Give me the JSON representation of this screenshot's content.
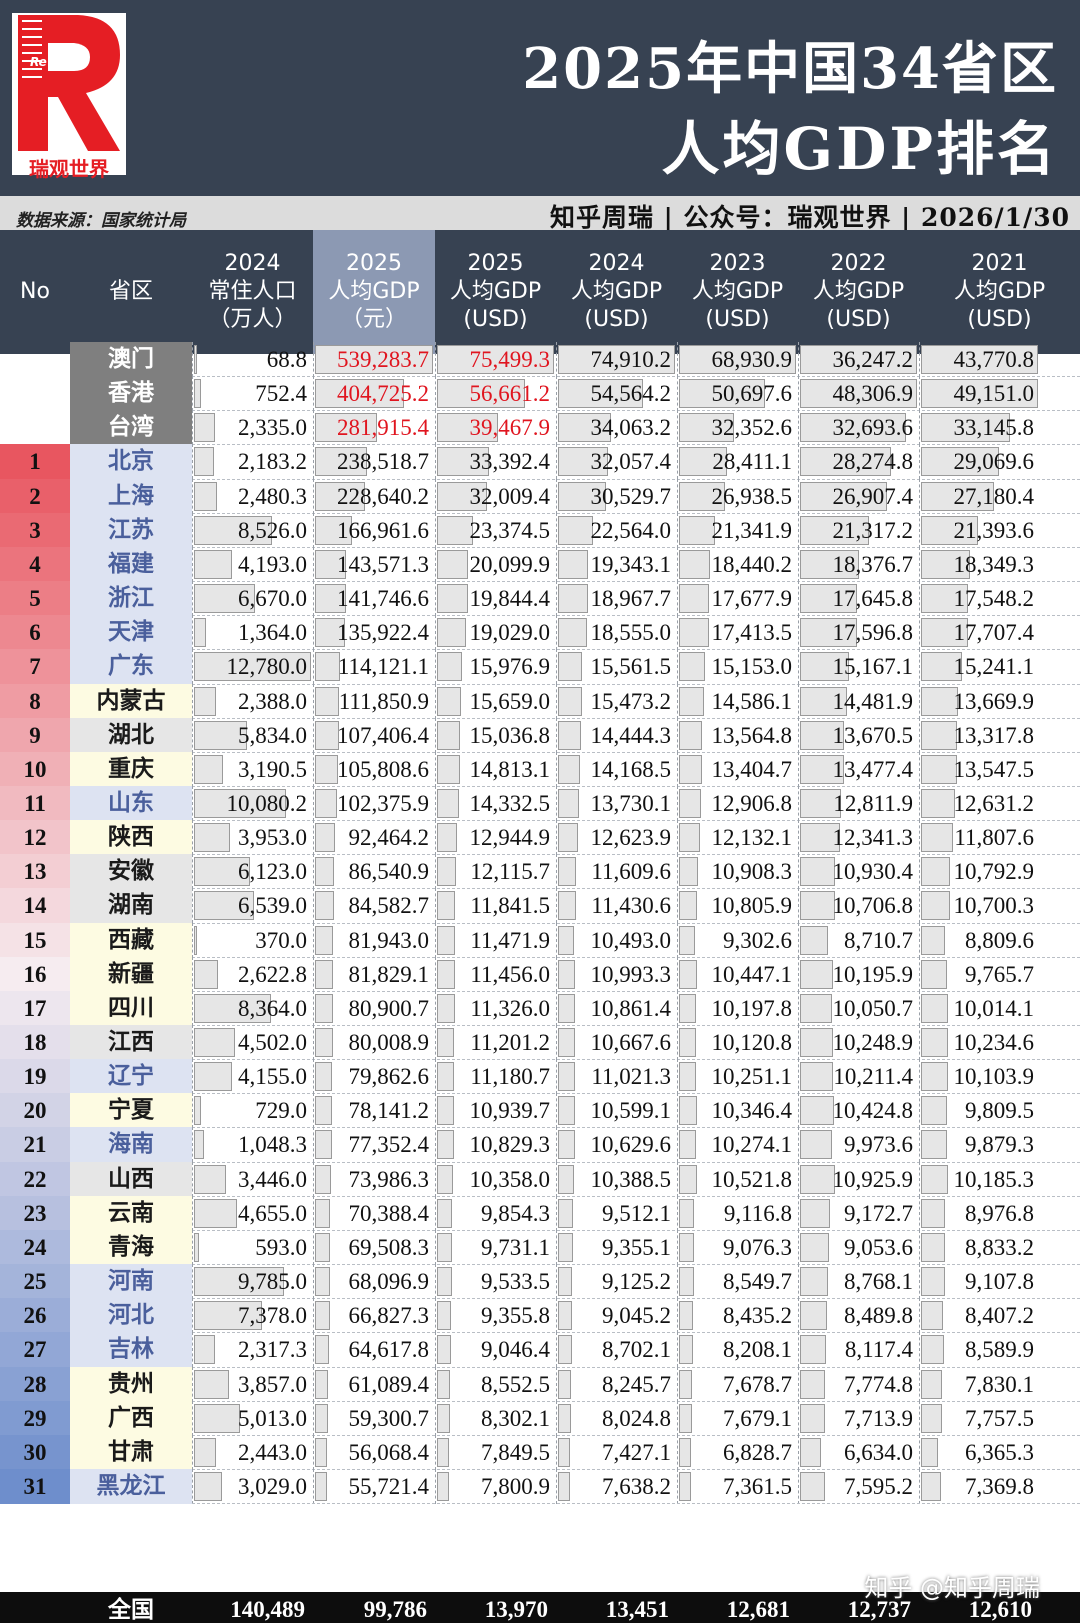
{
  "header": {
    "title_line1": "2025年中国34省区",
    "title_line2": "人均GDP排名",
    "logo_brand": "ReWorld",
    "logo_text": "瑞观世界"
  },
  "source_bar": {
    "left": "数据来源：国家统计局",
    "right": "知乎周瑞 | 公众号：瑞观世界 | 2026/1/30"
  },
  "columns": [
    {
      "key": "no",
      "lines": [
        "No"
      ]
    },
    {
      "key": "prov",
      "lines": [
        "省区"
      ]
    },
    {
      "key": "pop",
      "lines": [
        "2024",
        "常住人口",
        "（万人）"
      ]
    },
    {
      "key": "g25",
      "lines": [
        "2025",
        "人均GDP",
        "（元）"
      ]
    },
    {
      "key": "u25",
      "lines": [
        "2025",
        "人均GDP",
        "(USD)"
      ]
    },
    {
      "key": "u24",
      "lines": [
        "2024",
        "人均GDP",
        "(USD)"
      ]
    },
    {
      "key": "u23",
      "lines": [
        "2023",
        "人均GDP",
        "(USD)"
      ]
    },
    {
      "key": "u22",
      "lines": [
        "2022",
        "人均GDP",
        "(USD)"
      ]
    },
    {
      "key": "u21",
      "lines": [
        "2021",
        "人均GDP",
        "(USD)"
      ]
    }
  ],
  "colors": {
    "header_bg": "#374252",
    "highlight_header": "#8c99b3",
    "accent_red": "#e0151f",
    "sar_name_bg": "#7f7f7f",
    "blue_name_bg": "#dde3f2",
    "yellow_name_bg": "#fdfbe2",
    "gray_name_bg": "#e6e6e6"
  },
  "rows": [
    {
      "no": "",
      "prov": "澳门",
      "style": "sar",
      "pop": "68.8",
      "g25": "539,283.7",
      "u25": "75,499.3",
      "u24": "74,910.2",
      "u23": "68,930.9",
      "u22": "36,247.2",
      "u21": "43,770.8"
    },
    {
      "no": "",
      "prov": "香港",
      "style": "sar",
      "pop": "752.4",
      "g25": "404,725.2",
      "u25": "56,661.2",
      "u24": "54,564.2",
      "u23": "50,697.6",
      "u22": "48,306.9",
      "u21": "49,151.0"
    },
    {
      "no": "",
      "prov": "台湾",
      "style": "sar",
      "pop": "2,335.0",
      "g25": "281,915.4",
      "u25": "39,467.9",
      "u24": "34,063.2",
      "u23": "32,352.6",
      "u22": "32,693.6",
      "u21": "33,145.8"
    },
    {
      "no": "1",
      "prov": "北京",
      "style": "blue",
      "pop": "2,183.2",
      "g25": "238,518.7",
      "u25": "33,392.4",
      "u24": "32,057.4",
      "u23": "28,411.1",
      "u22": "28,274.8",
      "u21": "29,069.6"
    },
    {
      "no": "2",
      "prov": "上海",
      "style": "blue",
      "pop": "2,480.3",
      "g25": "228,640.2",
      "u25": "32,009.4",
      "u24": "30,529.7",
      "u23": "26,938.5",
      "u22": "26,907.4",
      "u21": "27,180.4"
    },
    {
      "no": "3",
      "prov": "江苏",
      "style": "blue",
      "pop": "8,526.0",
      "g25": "166,961.6",
      "u25": "23,374.5",
      "u24": "22,564.0",
      "u23": "21,341.9",
      "u22": "21,317.2",
      "u21": "21,393.6"
    },
    {
      "no": "4",
      "prov": "福建",
      "style": "blue",
      "pop": "4,193.0",
      "g25": "143,571.3",
      "u25": "20,099.9",
      "u24": "19,343.1",
      "u23": "18,440.2",
      "u22": "18,376.7",
      "u21": "18,349.3"
    },
    {
      "no": "5",
      "prov": "浙江",
      "style": "blue",
      "pop": "6,670.0",
      "g25": "141,746.6",
      "u25": "19,844.4",
      "u24": "18,967.7",
      "u23": "17,677.9",
      "u22": "17,645.8",
      "u21": "17,548.2"
    },
    {
      "no": "6",
      "prov": "天津",
      "style": "blue",
      "pop": "1,364.0",
      "g25": "135,922.4",
      "u25": "19,029.0",
      "u24": "18,555.0",
      "u23": "17,413.5",
      "u22": "17,596.8",
      "u21": "17,707.4"
    },
    {
      "no": "7",
      "prov": "广东",
      "style": "blue",
      "pop": "12,780.0",
      "g25": "114,121.1",
      "u25": "15,976.9",
      "u24": "15,561.5",
      "u23": "15,153.0",
      "u22": "15,167.1",
      "u21": "15,241.1"
    },
    {
      "no": "8",
      "prov": "内蒙古",
      "style": "yellow",
      "pop": "2,388.0",
      "g25": "111,850.9",
      "u25": "15,659.0",
      "u24": "15,473.2",
      "u23": "14,586.1",
      "u22": "14,481.9",
      "u21": "13,669.9"
    },
    {
      "no": "9",
      "prov": "湖北",
      "style": "gray",
      "pop": "5,834.0",
      "g25": "107,406.4",
      "u25": "15,036.8",
      "u24": "14,444.3",
      "u23": "13,564.8",
      "u22": "13,670.5",
      "u21": "13,317.8"
    },
    {
      "no": "10",
      "prov": "重庆",
      "style": "yellow",
      "pop": "3,190.5",
      "g25": "105,808.6",
      "u25": "14,813.1",
      "u24": "14,168.5",
      "u23": "13,404.7",
      "u22": "13,477.4",
      "u21": "13,547.5"
    },
    {
      "no": "11",
      "prov": "山东",
      "style": "blue",
      "pop": "10,080.2",
      "g25": "102,375.9",
      "u25": "14,332.5",
      "u24": "13,730.1",
      "u23": "12,906.8",
      "u22": "12,811.9",
      "u21": "12,631.2"
    },
    {
      "no": "12",
      "prov": "陕西",
      "style": "yellow",
      "pop": "3,953.0",
      "g25": "92,464.2",
      "u25": "12,944.9",
      "u24": "12,623.9",
      "u23": "12,132.1",
      "u22": "12,341.3",
      "u21": "11,807.6"
    },
    {
      "no": "13",
      "prov": "安徽",
      "style": "gray",
      "pop": "6,123.0",
      "g25": "86,540.9",
      "u25": "12,115.7",
      "u24": "11,609.6",
      "u23": "10,908.3",
      "u22": "10,930.4",
      "u21": "10,792.9"
    },
    {
      "no": "14",
      "prov": "湖南",
      "style": "gray",
      "pop": "6,539.0",
      "g25": "84,582.7",
      "u25": "11,841.5",
      "u24": "11,430.6",
      "u23": "10,805.9",
      "u22": "10,706.8",
      "u21": "10,700.3"
    },
    {
      "no": "15",
      "prov": "西藏",
      "style": "yellow",
      "pop": "370.0",
      "g25": "81,943.0",
      "u25": "11,471.9",
      "u24": "10,493.0",
      "u23": "9,302.6",
      "u22": "8,710.7",
      "u21": "8,809.6"
    },
    {
      "no": "16",
      "prov": "新疆",
      "style": "yellow",
      "pop": "2,622.8",
      "g25": "81,829.1",
      "u25": "11,456.0",
      "u24": "10,993.3",
      "u23": "10,447.1",
      "u22": "10,195.9",
      "u21": "9,765.7"
    },
    {
      "no": "17",
      "prov": "四川",
      "style": "yellow",
      "pop": "8,364.0",
      "g25": "80,900.7",
      "u25": "11,326.0",
      "u24": "10,861.4",
      "u23": "10,197.8",
      "u22": "10,050.7",
      "u21": "10,014.1"
    },
    {
      "no": "18",
      "prov": "江西",
      "style": "gray",
      "pop": "4,502.0",
      "g25": "80,008.9",
      "u25": "11,201.2",
      "u24": "10,667.6",
      "u23": "10,120.8",
      "u22": "10,248.9",
      "u21": "10,234.6"
    },
    {
      "no": "19",
      "prov": "辽宁",
      "style": "blue",
      "pop": "4,155.0",
      "g25": "79,862.6",
      "u25": "11,180.7",
      "u24": "11,021.3",
      "u23": "10,251.1",
      "u22": "10,211.4",
      "u21": "10,103.9"
    },
    {
      "no": "20",
      "prov": "宁夏",
      "style": "yellow",
      "pop": "729.0",
      "g25": "78,141.2",
      "u25": "10,939.7",
      "u24": "10,599.1",
      "u23": "10,346.4",
      "u22": "10,424.8",
      "u21": "9,809.5"
    },
    {
      "no": "21",
      "prov": "海南",
      "style": "blue",
      "pop": "1,048.3",
      "g25": "77,352.4",
      "u25": "10,829.3",
      "u24": "10,629.6",
      "u23": "10,274.1",
      "u22": "9,973.6",
      "u21": "9,879.3"
    },
    {
      "no": "22",
      "prov": "山西",
      "style": "gray",
      "pop": "3,446.0",
      "g25": "73,986.3",
      "u25": "10,358.0",
      "u24": "10,388.5",
      "u23": "10,521.8",
      "u22": "10,925.9",
      "u21": "10,185.3"
    },
    {
      "no": "23",
      "prov": "云南",
      "style": "yellow",
      "pop": "4,655.0",
      "g25": "70,388.4",
      "u25": "9,854.3",
      "u24": "9,512.1",
      "u23": "9,116.8",
      "u22": "9,172.7",
      "u21": "8,976.8"
    },
    {
      "no": "24",
      "prov": "青海",
      "style": "yellow",
      "pop": "593.0",
      "g25": "69,508.3",
      "u25": "9,731.1",
      "u24": "9,355.1",
      "u23": "9,076.3",
      "u22": "9,053.6",
      "u21": "8,833.2"
    },
    {
      "no": "25",
      "prov": "河南",
      "style": "blue",
      "pop": "9,785.0",
      "g25": "68,096.9",
      "u25": "9,533.5",
      "u24": "9,125.2",
      "u23": "8,549.7",
      "u22": "8,768.1",
      "u21": "9,107.8"
    },
    {
      "no": "26",
      "prov": "河北",
      "style": "blue",
      "pop": "7,378.0",
      "g25": "66,827.3",
      "u25": "9,355.8",
      "u24": "9,045.2",
      "u23": "8,435.2",
      "u22": "8,489.8",
      "u21": "8,407.2"
    },
    {
      "no": "27",
      "prov": "吉林",
      "style": "blue",
      "pop": "2,317.3",
      "g25": "64,617.8",
      "u25": "9,046.4",
      "u24": "8,702.1",
      "u23": "8,208.1",
      "u22": "8,117.4",
      "u21": "8,589.9"
    },
    {
      "no": "28",
      "prov": "贵州",
      "style": "yellow",
      "pop": "3,857.0",
      "g25": "61,089.4",
      "u25": "8,552.5",
      "u24": "8,245.7",
      "u23": "7,678.7",
      "u22": "7,774.8",
      "u21": "7,830.1"
    },
    {
      "no": "29",
      "prov": "广西",
      "style": "yellow",
      "pop": "5,013.0",
      "g25": "59,300.7",
      "u25": "8,302.1",
      "u24": "8,024.8",
      "u23": "7,679.1",
      "u22": "7,713.9",
      "u21": "7,757.5"
    },
    {
      "no": "30",
      "prov": "甘肃",
      "style": "yellow",
      "pop": "2,443.0",
      "g25": "56,068.4",
      "u25": "7,849.5",
      "u24": "7,427.1",
      "u23": "6,828.7",
      "u22": "6,634.0",
      "u21": "6,365.3"
    },
    {
      "no": "31",
      "prov": "黑龙江",
      "style": "blue",
      "pop": "3,029.0",
      "g25": "55,721.4",
      "u25": "7,800.9",
      "u24": "7,638.2",
      "u23": "7,361.5",
      "u22": "7,595.2",
      "u21": "7,369.8"
    }
  ],
  "total": {
    "label": "全国",
    "pop": "140,489",
    "g25": "99,786",
    "u25": "13,970",
    "u24": "13,451",
    "u23": "12,681",
    "u22": "12,737",
    "u21": "12,610"
  },
  "watermark": "知乎 @知乎周瑞"
}
